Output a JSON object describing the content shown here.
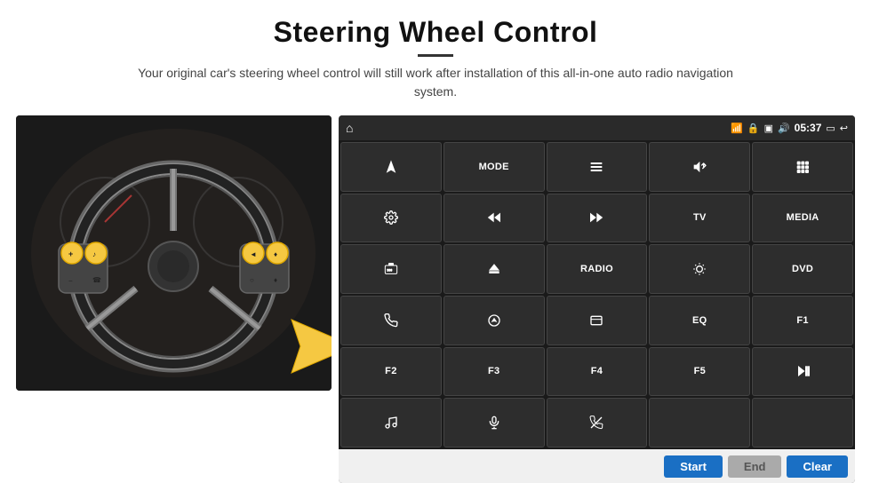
{
  "header": {
    "title": "Steering Wheel Control",
    "description": "Your original car's steering wheel control will still work after installation of this all-in-one auto radio navigation system."
  },
  "status_bar": {
    "time": "05:37"
  },
  "grid_buttons": [
    {
      "id": "row1-col1",
      "type": "icon",
      "icon": "navigation-arrow"
    },
    {
      "id": "row1-col2",
      "type": "text",
      "label": "MODE"
    },
    {
      "id": "row1-col3",
      "type": "icon",
      "icon": "list"
    },
    {
      "id": "row1-col4",
      "type": "icon",
      "icon": "volume-mute"
    },
    {
      "id": "row1-col5",
      "type": "icon",
      "icon": "apps-grid"
    },
    {
      "id": "row2-col1",
      "type": "icon",
      "icon": "settings"
    },
    {
      "id": "row2-col2",
      "type": "icon",
      "icon": "rewind"
    },
    {
      "id": "row2-col3",
      "type": "icon",
      "icon": "fast-forward"
    },
    {
      "id": "row2-col4",
      "type": "text",
      "label": "TV"
    },
    {
      "id": "row2-col5",
      "type": "text",
      "label": "MEDIA"
    },
    {
      "id": "row3-col1",
      "type": "icon",
      "icon": "camera-360"
    },
    {
      "id": "row3-col2",
      "type": "icon",
      "icon": "eject"
    },
    {
      "id": "row3-col3",
      "type": "text",
      "label": "RADIO"
    },
    {
      "id": "row3-col4",
      "type": "icon",
      "icon": "brightness"
    },
    {
      "id": "row3-col5",
      "type": "text",
      "label": "DVD"
    },
    {
      "id": "row4-col1",
      "type": "icon",
      "icon": "phone"
    },
    {
      "id": "row4-col2",
      "type": "icon",
      "icon": "navigation"
    },
    {
      "id": "row4-col3",
      "type": "icon",
      "icon": "window"
    },
    {
      "id": "row4-col4",
      "type": "text",
      "label": "EQ"
    },
    {
      "id": "row4-col5",
      "type": "text",
      "label": "F1"
    },
    {
      "id": "row5-col1",
      "type": "text",
      "label": "F2"
    },
    {
      "id": "row5-col2",
      "type": "text",
      "label": "F3"
    },
    {
      "id": "row5-col3",
      "type": "text",
      "label": "F4"
    },
    {
      "id": "row5-col4",
      "type": "text",
      "label": "F5"
    },
    {
      "id": "row5-col5",
      "type": "icon",
      "icon": "play-pause"
    },
    {
      "id": "row6-col1",
      "type": "icon",
      "icon": "music"
    },
    {
      "id": "row6-col2",
      "type": "icon",
      "icon": "microphone"
    },
    {
      "id": "row6-col3",
      "type": "icon",
      "icon": "mute-call"
    }
  ],
  "action_bar": {
    "start_label": "Start",
    "end_label": "End",
    "clear_label": "Clear"
  }
}
